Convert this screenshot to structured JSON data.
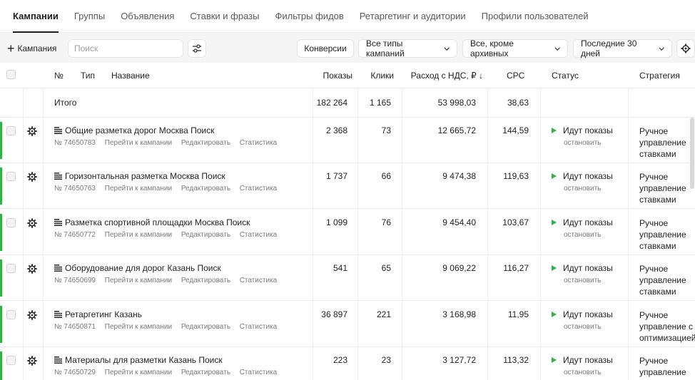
{
  "tabs": [
    {
      "label": "Кампании",
      "active": true
    },
    {
      "label": "Группы",
      "active": false
    },
    {
      "label": "Объявления",
      "active": false
    },
    {
      "label": "Ставки и фразы",
      "active": false
    },
    {
      "label": "Фильтры фидов",
      "active": false
    },
    {
      "label": "Ретаргетинг и аудитории",
      "active": false
    },
    {
      "label": "Профили пользователей",
      "active": false
    }
  ],
  "toolbar": {
    "add_label": "Кампания",
    "search_placeholder": "Поиск",
    "conversions_label": "Конверсии",
    "campaign_types_label": "Все типы кампаний",
    "archive_filter_label": "Все, кроме архивных",
    "period_label": "Последние 30 дней"
  },
  "columns": {
    "number": "№",
    "type": "Тип",
    "name": "Название",
    "shows": "Показы",
    "clicks": "Клики",
    "spend": "Расход с НДС, ₽ ↓",
    "cpc": "CPC",
    "status": "Статус",
    "strategy": "Стратегия"
  },
  "total": {
    "label": "Итого",
    "shows": "182 264",
    "clicks": "1 165",
    "spend": "53 998,03",
    "cpc": "38,63"
  },
  "row_links": {
    "go": "Перейти к кампании",
    "edit": "Редактировать",
    "stats": "Статистика"
  },
  "rows": [
    {
      "name": "Общие разметка дорог Москва Поиск",
      "id": "№ 74650783",
      "shows": "2 368",
      "clicks": "73",
      "spend": "12 665,72",
      "cpc": "144,59",
      "status": "Идут показы",
      "status_action": "остановить",
      "strategy": "Ручное управление ставками"
    },
    {
      "name": "Горизонтальная разметка Москва Поиск",
      "id": "№ 74650763",
      "shows": "1 737",
      "clicks": "66",
      "spend": "9 474,38",
      "cpc": "119,63",
      "status": "Идут показы",
      "status_action": "остановить",
      "strategy": "Ручное управление ставками"
    },
    {
      "name": "Разметка спортивной площадки Москва Поиск",
      "id": "№ 74650772",
      "shows": "1 099",
      "clicks": "76",
      "spend": "9 454,40",
      "cpc": "103,67",
      "status": "Идут показы",
      "status_action": "остановить",
      "strategy": "Ручное управление ставками"
    },
    {
      "name": "Оборудование для дорог Казань Поиск",
      "id": "№ 74650699",
      "shows": "541",
      "clicks": "65",
      "spend": "9 069,22",
      "cpc": "116,27",
      "status": "Идут показы",
      "status_action": "остановить",
      "strategy": "Ручное управление ставками"
    },
    {
      "name": "Ретаргетинг Казань",
      "id": "№ 74650871",
      "shows": "36 897",
      "clicks": "221",
      "spend": "3 168,98",
      "cpc": "11,95",
      "status": "Идут показы",
      "status_action": "остановить",
      "strategy": "Ручное управление с оптимизацией"
    },
    {
      "name": "Материалы для разметки Казань Поиск",
      "id": "№ 74650729",
      "shows": "223",
      "clicks": "23",
      "spend": "3 127,72",
      "cpc": "113,32",
      "status": "Идут показы",
      "status_action": "остановить",
      "strategy": "Ручное управление ставками"
    }
  ],
  "colors": {
    "accent": "#2fb342",
    "toolbar_bg": "#f5f5f5"
  }
}
